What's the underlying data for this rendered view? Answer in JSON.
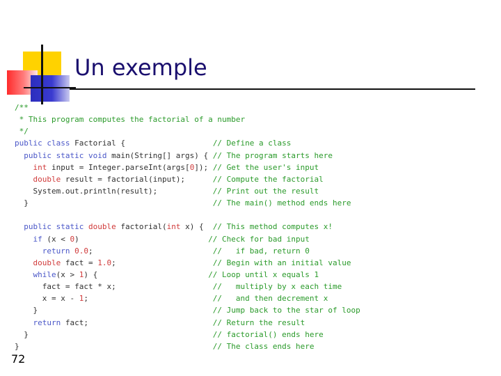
{
  "title": "Un exemple",
  "page_number": "72",
  "code_lines": [
    {
      "type": "comment",
      "text": "/**"
    },
    {
      "type": "comment",
      "text": " * This program computes the factorial of a number"
    },
    {
      "type": "comment",
      "text": " */"
    },
    {
      "type": "code",
      "tokens": [
        {
          "k": "kw",
          "t": "public class"
        },
        {
          "k": "t",
          "t": " Factorial {"
        },
        {
          "k": "pad",
          "t": "                   "
        },
        {
          "k": "cm",
          "t": "// Define a class"
        }
      ]
    },
    {
      "type": "code",
      "tokens": [
        {
          "k": "t",
          "t": "  "
        },
        {
          "k": "kw",
          "t": "public static void"
        },
        {
          "k": "t",
          "t": " main(String[] args) { "
        },
        {
          "k": "cm",
          "t": "// The program starts here"
        }
      ]
    },
    {
      "type": "code",
      "tokens": [
        {
          "k": "t",
          "t": "    "
        },
        {
          "k": "num",
          "t": "int"
        },
        {
          "k": "t",
          "t": " input = Integer.parseInt(args["
        },
        {
          "k": "num",
          "t": "0"
        },
        {
          "k": "t",
          "t": "]); "
        },
        {
          "k": "cm",
          "t": "// Get the user's input"
        }
      ]
    },
    {
      "type": "code",
      "tokens": [
        {
          "k": "t",
          "t": "    "
        },
        {
          "k": "num",
          "t": "double"
        },
        {
          "k": "t",
          "t": " result = factorial(input);      "
        },
        {
          "k": "cm",
          "t": "// Compute the factorial"
        }
      ]
    },
    {
      "type": "code",
      "tokens": [
        {
          "k": "t",
          "t": "    System.out.println(result);            "
        },
        {
          "k": "cm",
          "t": "// Print out the result"
        }
      ]
    },
    {
      "type": "code",
      "tokens": [
        {
          "k": "t",
          "t": "  }                                        "
        },
        {
          "k": "cm",
          "t": "// The main() method ends here"
        }
      ]
    },
    {
      "type": "blank",
      "tokens": []
    },
    {
      "type": "code",
      "tokens": [
        {
          "k": "t",
          "t": "  "
        },
        {
          "k": "kw",
          "t": "public static"
        },
        {
          "k": "t",
          "t": " "
        },
        {
          "k": "num",
          "t": "double"
        },
        {
          "k": "t",
          "t": " factorial("
        },
        {
          "k": "num",
          "t": "int"
        },
        {
          "k": "t",
          "t": " x) {  "
        },
        {
          "k": "cm",
          "t": "// This method computes x!"
        }
      ]
    },
    {
      "type": "code",
      "tokens": [
        {
          "k": "t",
          "t": "    "
        },
        {
          "k": "kw",
          "t": "if"
        },
        {
          "k": "t",
          "t": " (x < "
        },
        {
          "k": "num",
          "t": "0"
        },
        {
          "k": "t",
          "t": ")                            "
        },
        {
          "k": "cm",
          "t": "// Check for bad input"
        }
      ]
    },
    {
      "type": "code",
      "tokens": [
        {
          "k": "t",
          "t": "      "
        },
        {
          "k": "kw",
          "t": "return"
        },
        {
          "k": "t",
          "t": " "
        },
        {
          "k": "num",
          "t": "0.0"
        },
        {
          "k": "t",
          "t": ";                          "
        },
        {
          "k": "cm",
          "t": "//   if bad, return 0"
        }
      ]
    },
    {
      "type": "code",
      "tokens": [
        {
          "k": "t",
          "t": "    "
        },
        {
          "k": "num",
          "t": "double"
        },
        {
          "k": "t",
          "t": " fact = "
        },
        {
          "k": "num",
          "t": "1.0"
        },
        {
          "k": "t",
          "t": ";                     "
        },
        {
          "k": "cm",
          "t": "// Begin with an initial value"
        }
      ]
    },
    {
      "type": "code",
      "tokens": [
        {
          "k": "t",
          "t": "    "
        },
        {
          "k": "kw",
          "t": "while"
        },
        {
          "k": "t",
          "t": "(x > "
        },
        {
          "k": "num",
          "t": "1"
        },
        {
          "k": "t",
          "t": ") {                        "
        },
        {
          "k": "cm",
          "t": "// Loop until x equals 1"
        }
      ]
    },
    {
      "type": "code",
      "tokens": [
        {
          "k": "t",
          "t": "      fact = fact * x;                     "
        },
        {
          "k": "cm",
          "t": "//   multiply by x each time"
        }
      ]
    },
    {
      "type": "code",
      "tokens": [
        {
          "k": "t",
          "t": "      x = x - "
        },
        {
          "k": "num",
          "t": "1"
        },
        {
          "k": "t",
          "t": ";                           "
        },
        {
          "k": "cm",
          "t": "//   and then decrement x"
        }
      ]
    },
    {
      "type": "code",
      "tokens": [
        {
          "k": "t",
          "t": "    }                                      "
        },
        {
          "k": "cm",
          "t": "// Jump back to the star of loop"
        }
      ]
    },
    {
      "type": "code",
      "tokens": [
        {
          "k": "t",
          "t": "    "
        },
        {
          "k": "kw",
          "t": "return"
        },
        {
          "k": "t",
          "t": " fact;                           "
        },
        {
          "k": "cm",
          "t": "// Return the result"
        }
      ]
    },
    {
      "type": "code",
      "tokens": [
        {
          "k": "t",
          "t": "  }                                        "
        },
        {
          "k": "cm",
          "t": "// factorial() ends here"
        }
      ]
    },
    {
      "type": "code",
      "tokens": [
        {
          "k": "t",
          "t": "}                                          "
        },
        {
          "k": "cm",
          "t": "// The class ends here"
        }
      ]
    }
  ]
}
